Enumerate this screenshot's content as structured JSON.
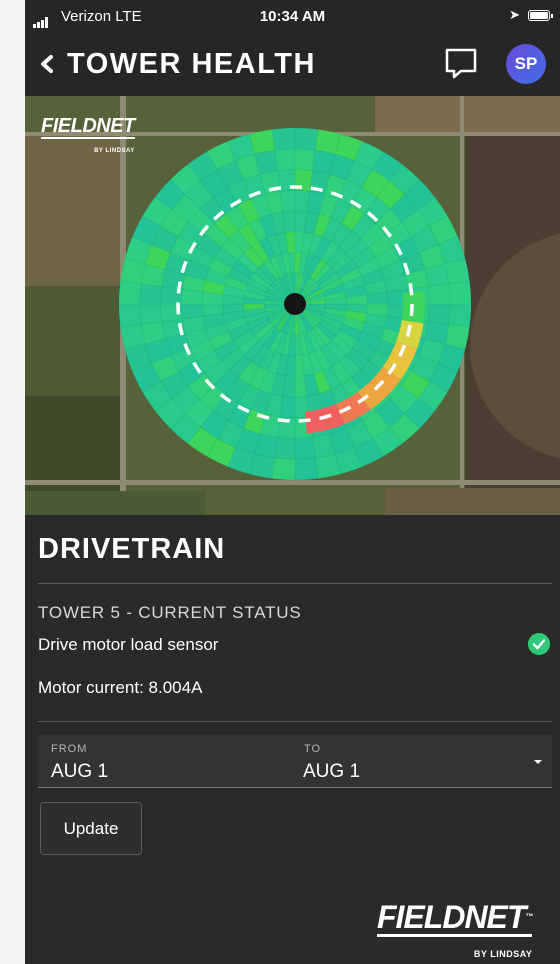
{
  "status_bar": {
    "carrier": "Verizon  LTE",
    "time": "10:34 AM",
    "location_icon": "location-arrow-icon",
    "battery_icon": "battery-icon"
  },
  "header": {
    "back_icon": "chevron-left-icon",
    "title": "TOWER HEALTH",
    "chat_icon": "chat-bubble-icon",
    "avatar_initials": "SP"
  },
  "map": {
    "logo_text": "FIELDNET",
    "logo_subtext": "BY LINDSAY",
    "heatmap_colors": {
      "base": "#28c98c",
      "green": "#3fd45a",
      "yellow": "#d6d640",
      "orange": "#eda63e",
      "red": "#f06060",
      "hub": "#151515",
      "path": "#ffffff"
    }
  },
  "section": {
    "title": "DRIVETRAIN",
    "tower_status": "TOWER 5 - CURRENT STATUS",
    "sensor_label": "Drive motor load sensor",
    "sensor_status_icon": "check-circle-icon",
    "sensor_status_color": "#2fc97a",
    "motor_current": "Motor current: 8.004A"
  },
  "date_range": {
    "from_label": "FROM",
    "from_value": "AUG 1",
    "to_label": "TO",
    "to_value": "AUG 1"
  },
  "update_button": "Update",
  "footer_logo": {
    "text": "FIELDNET",
    "trademark": "™",
    "subtext": "BY LINDSAY"
  }
}
